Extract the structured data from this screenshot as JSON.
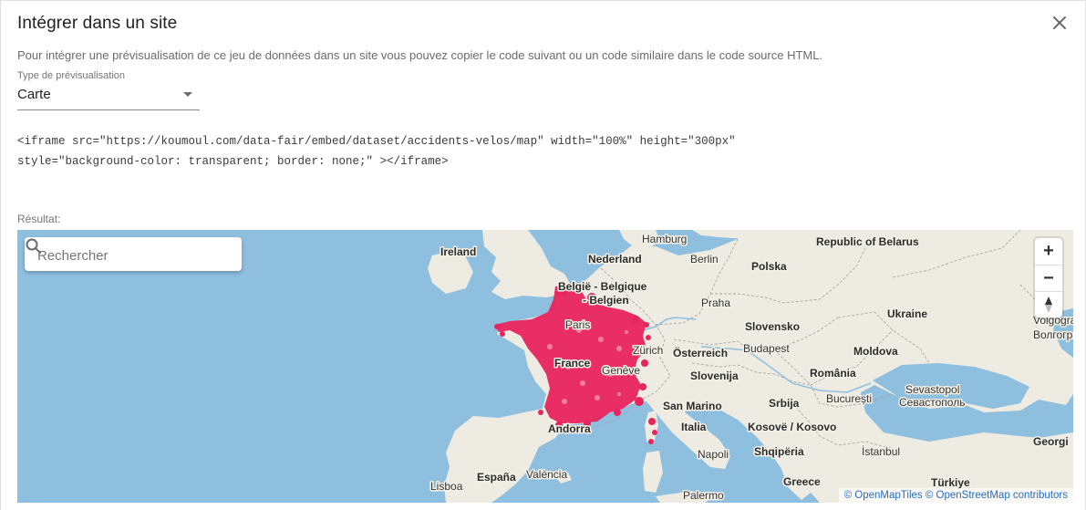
{
  "dialog": {
    "title": "Intégrer dans un site",
    "description": "Pour intégrer une prévisualisation de ce jeu de données dans un site vous pouvez copier le code suivant ou un code similaire dans le code source HTML."
  },
  "preview_select": {
    "label": "Type de prévisualisation",
    "value": "Carte"
  },
  "embed_code": {
    "line1": "<iframe src=\"https://koumoul.com/data-fair/embed/dataset/accidents-velos/map\" width=\"100%\" height=\"300px\"",
    "line2": "style=\"background-color: transparent; border: none;\" ></iframe>"
  },
  "result_label": "Résultat:",
  "map": {
    "search_placeholder": "Rechercher",
    "zoom_in": "+",
    "zoom_out": "−",
    "compass": "▲",
    "attribution_1": "© OpenMapTiles",
    "attribution_2": "© OpenStreetMap contributors",
    "water_color": "#8fbfdf",
    "land_color": "#eeece2",
    "point_color": "#e8245f",
    "place_labels": {
      "ireland": "Ireland",
      "hamburg": "Hamburg",
      "nederland": "Nederland",
      "berlin": "Berlin",
      "belarus": "Republic of Belarus",
      "polska": "Polska",
      "belgie": "België - Belgique",
      "belgien": "- Belgien",
      "praha": "Praha",
      "ukraine": "Ukraine",
      "paris": "Paris",
      "slovensko": "Slovensko",
      "volgograd_1": "Volgograd",
      "volgograd_2": "Волгоград",
      "zurich": "Zürich",
      "osterreich": "Österreich",
      "budapest": "Budapest",
      "moldova": "Moldova",
      "france": "France",
      "geneve": "Genève",
      "slovenija": "Slovenija",
      "romania": "România",
      "sevastopol_1": "Sevastopol",
      "sevastopol_2": "Севастополь",
      "san_marino": "San Marino",
      "srbija": "Srbija",
      "bucuresti": "București",
      "andorra": "Andorra",
      "italia": "Italia",
      "kosove": "Kosovë / Kosovo",
      "georgia": "Georgi",
      "napoli": "Napoli",
      "shqiperia": "Shqipëria",
      "istanbul": "İstanbul",
      "lisboa": "Lisboa",
      "espana": "España",
      "valencia": "València",
      "palermo": "Palermo",
      "greece": "Greece",
      "turkiye": "Türkiye"
    }
  }
}
